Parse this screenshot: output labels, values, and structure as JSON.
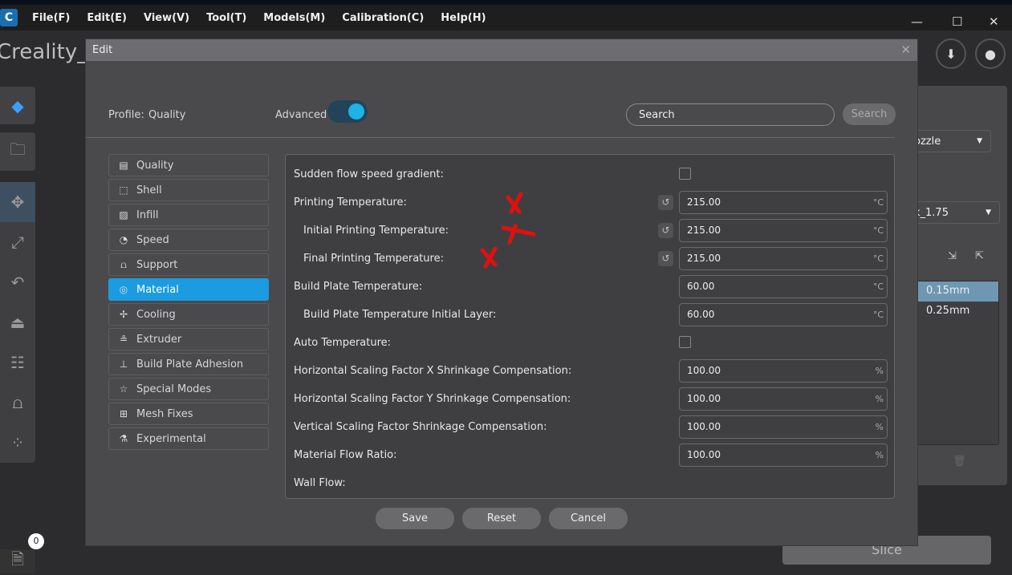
{
  "menubar": {
    "items": [
      "File(F)",
      "Edit(E)",
      "View(V)",
      "Tool(T)",
      "Models(M)",
      "Calibration(C)",
      "Help(H)"
    ]
  },
  "project_title": "Creality_P",
  "notification_count": "0",
  "right_panel": {
    "nozzle_select": "ozzle",
    "filament_select": "k_1.75",
    "layer_heights": [
      "0.15mm",
      "0.25mm"
    ],
    "slice_label": "Slice"
  },
  "dialog": {
    "title": "Edit",
    "profile_label": "Profile:",
    "profile_value": "Quality",
    "advanced_label": "Advanced",
    "advanced_on": true,
    "search_placeholder": "Search",
    "search_button": "Search",
    "categories": [
      {
        "label": "Quality",
        "icon": "quality-icon",
        "glyph": "▤"
      },
      {
        "label": "Shell",
        "icon": "shell-icon",
        "glyph": "⬚"
      },
      {
        "label": "Infill",
        "icon": "infill-icon",
        "glyph": "▨"
      },
      {
        "label": "Speed",
        "icon": "speed-icon",
        "glyph": "◔"
      },
      {
        "label": "Support",
        "icon": "support-icon",
        "glyph": "⩍"
      },
      {
        "label": "Material",
        "icon": "material-icon",
        "glyph": "◎",
        "active": true
      },
      {
        "label": "Cooling",
        "icon": "fan-icon",
        "glyph": "✢"
      },
      {
        "label": "Extruder",
        "icon": "extruder-icon",
        "glyph": "≗"
      },
      {
        "label": "Build Plate Adhesion",
        "icon": "build-plate-icon",
        "glyph": "⊥"
      },
      {
        "label": "Special Modes",
        "icon": "star-icon",
        "glyph": "☆"
      },
      {
        "label": "Mesh Fixes",
        "icon": "mesh-fix-icon",
        "glyph": "⊞"
      },
      {
        "label": "Experimental",
        "icon": "flask-icon",
        "glyph": "⚗"
      }
    ],
    "settings": [
      {
        "label": "Sudden flow speed gradient:",
        "type": "checkbox",
        "checked": false
      },
      {
        "label": "Printing Temperature:",
        "type": "number",
        "value": "215.00",
        "unit": "°C",
        "reset": true
      },
      {
        "label": "Initial Printing Temperature:",
        "type": "number",
        "value": "215.00",
        "unit": "°C",
        "reset": true,
        "indent": true
      },
      {
        "label": "Final Printing Temperature:",
        "type": "number",
        "value": "215.00",
        "unit": "°C",
        "reset": true,
        "indent": true
      },
      {
        "label": "Build Plate Temperature:",
        "type": "number",
        "value": "60.00",
        "unit": "°C"
      },
      {
        "label": "Build Plate Temperature Initial Layer:",
        "type": "number",
        "value": "60.00",
        "unit": "°C",
        "indent": true
      },
      {
        "label": "Auto Temperature:",
        "type": "checkbox",
        "checked": false
      },
      {
        "label": "Horizontal Scaling Factor X Shrinkage Compensation:",
        "type": "number",
        "value": "100.00",
        "unit": "%"
      },
      {
        "label": "Horizontal Scaling Factor Y Shrinkage Compensation:",
        "type": "number",
        "value": "100.00",
        "unit": "%"
      },
      {
        "label": "Vertical Scaling Factor Shrinkage Compensation:",
        "type": "number",
        "value": "100.00",
        "unit": "%"
      },
      {
        "label": "Material Flow Ratio:",
        "type": "number",
        "value": "100.00",
        "unit": "%"
      },
      {
        "label": "Wall Flow:",
        "type": "none"
      }
    ],
    "buttons": {
      "save": "Save",
      "reset": "Reset",
      "cancel": "Cancel"
    }
  },
  "colors": {
    "accent": "#1b9be0",
    "annotation": "#e01010"
  }
}
